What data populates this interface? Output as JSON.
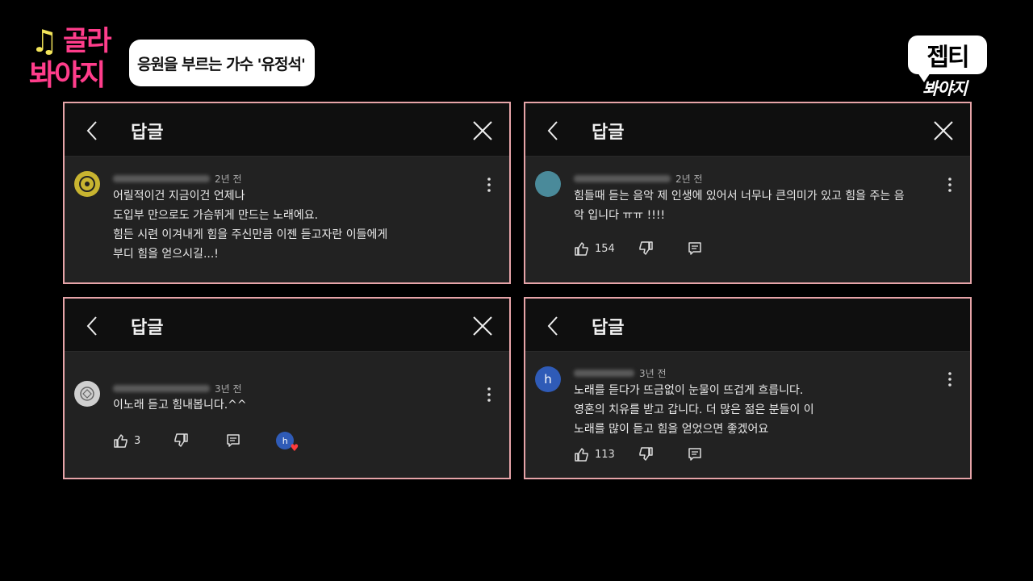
{
  "show": {
    "logo_note": "♫",
    "logo_line1": "골라",
    "logo_line2": "봐야지",
    "episode_title": "응원을 부르는 가수 '유정석'",
    "brand_main": "젭티",
    "brand_sub": "봐야지"
  },
  "panels": [
    {
      "header_title": "답글",
      "age": "2년 전",
      "text": "어릴적이건 지금이건 언제나\n도입부 만으로도 가슴뛰게 만드는 노래에요.\n힘든 시련 이겨내게 힘을 주신만큼 이젠 듣고자란 이들에게\n부디 힘을 얻으시길...!",
      "avatar_color": "#c8b430",
      "avatar_label": ""
    },
    {
      "header_title": "답글",
      "age": "2년 전",
      "text": "힘들때 듣는 음악 제 인생에 있어서 너무나 큰의미가 있고 힘을 주는 음\n악 입니다 ㅠㅠ !!!!",
      "likes": "154",
      "avatar_color": "#4a8a9a",
      "avatar_label": ""
    },
    {
      "header_title": "답글",
      "age": "3년 전",
      "text": "이노래 듣고 힘내봅니다.^^",
      "likes": "3",
      "avatar_color": "#cfcfcf",
      "avatar_label": "",
      "creator_label": "h"
    },
    {
      "header_title": "답글",
      "age": "3년 전",
      "text": "노래를 듣다가 뜨금없이 눈물이 뜨겁게 흐릅니다.\n영혼의 치유를 받고 갑니다. 더 많은 젊은 분들이 이\n노래를 많이 듣고 힘을 얻었으면 좋겠어요",
      "likes": "113",
      "avatar_color": "#2f5bb7",
      "avatar_label": "h"
    }
  ],
  "colors": {
    "panel_border": "#e6a4a8",
    "logo_pink": "#ff3d8b",
    "logo_yellow": "#f3e55a",
    "heart_red": "#ff3b3b"
  }
}
